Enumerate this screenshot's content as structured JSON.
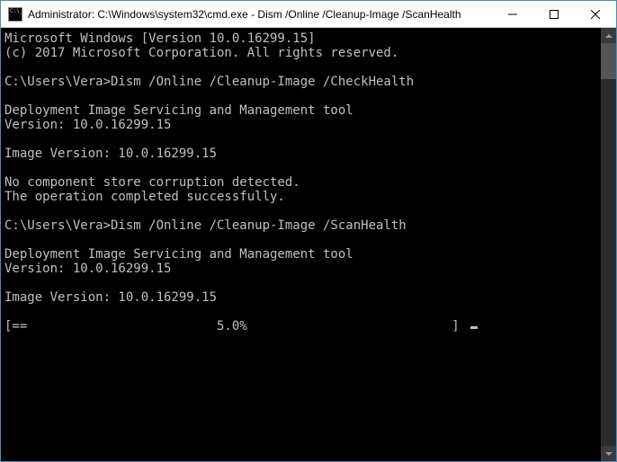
{
  "window": {
    "title": "Administrator: C:\\Windows\\system32\\cmd.exe - Dism  /Online /Cleanup-Image /ScanHealth"
  },
  "terminal": {
    "line1": "Microsoft Windows [Version 10.0.16299.15]",
    "line2": "(c) 2017 Microsoft Corporation. All rights reserved.",
    "blank1": "",
    "prompt1": "C:\\Users\\Vera>Dism /Online /Cleanup-Image /CheckHealth",
    "blank2": "",
    "tool1a": "Deployment Image Servicing and Management tool",
    "tool1b": "Version: 10.0.16299.15",
    "blank3": "",
    "imgver1": "Image Version: 10.0.16299.15",
    "blank4": "",
    "result1a": "No component store corruption detected.",
    "result1b": "The operation completed successfully.",
    "blank5": "",
    "prompt2": "C:\\Users\\Vera>Dism /Online /Cleanup-Image /ScanHealth",
    "blank6": "",
    "tool2a": "Deployment Image Servicing and Management tool",
    "tool2b": "Version: 10.0.16299.15",
    "blank7": "",
    "imgver2": "Image Version: 10.0.16299.15",
    "blank8": "",
    "progress": "[==                         5.0%                           ] "
  }
}
